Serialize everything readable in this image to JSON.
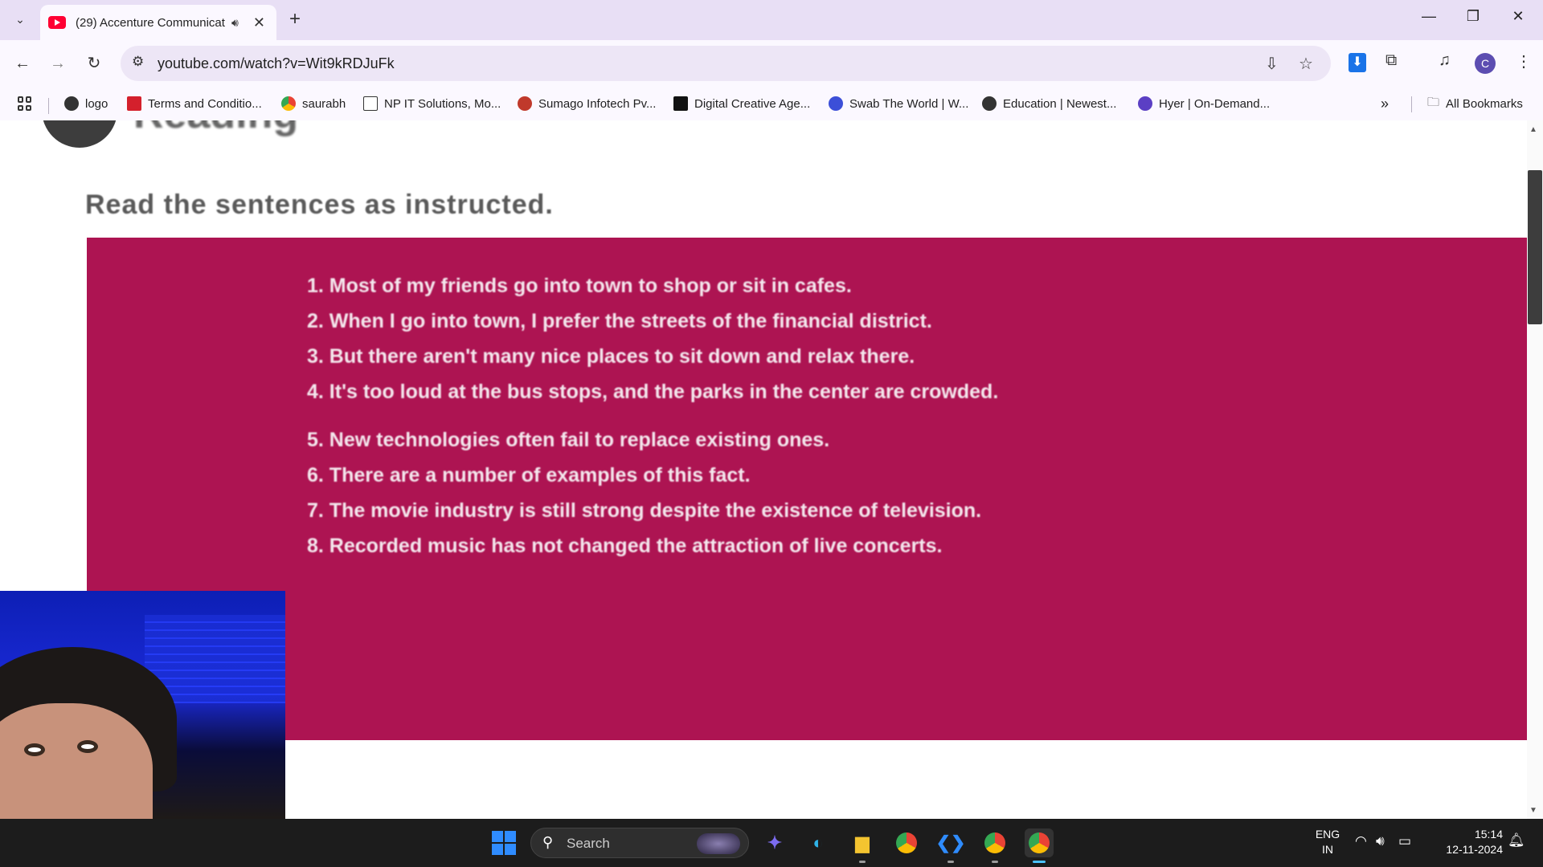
{
  "browser": {
    "tab_title": "(29) Accenture Communicat",
    "url": "youtube.com/watch?v=Wit9kRDJuFk",
    "bookmarks": [
      {
        "label": "logo",
        "color": "#333333"
      },
      {
        "label": "Terms and Conditio...",
        "color": "#d4202c"
      },
      {
        "label": "saurabh",
        "color": "#e8a33a"
      },
      {
        "label": "NP IT Solutions, Mo...",
        "color": "#222222"
      },
      {
        "label": "Sumago Infotech Pv...",
        "color": "#c0392b"
      },
      {
        "label": "Digital Creative Age...",
        "color": "#111111"
      },
      {
        "label": "Swab The World | W...",
        "color": "#3c4fd8"
      },
      {
        "label": "Education | Newest...",
        "color": "#333333"
      },
      {
        "label": "Hyer | On-Demand...",
        "color": "#5b3fc4"
      }
    ],
    "all_bookmarks_label": "All Bookmarks",
    "profile_initial": "C"
  },
  "page": {
    "heading_partial": "Reading",
    "instruction": "Read the sentences as instructed.",
    "sentences": [
      "1. Most of my friends go into town to shop or sit in cafes.",
      "2. When I go into town, I prefer the streets of the financial district.",
      "3. But there aren't many nice places to sit down and relax there.",
      "4. It's too loud at the bus stops, and the parks in the center are crowded.",
      "5. New technologies often fail to replace existing ones.",
      "6. There are a number of examples of this fact.",
      "7. The movie industry is still strong despite the existence of television.",
      "8. Recorded music has not changed the attraction of live concerts."
    ],
    "panel_color": "#ad1452"
  },
  "taskbar": {
    "search_placeholder": "Search",
    "lang_line1": "ENG",
    "lang_line2": "IN",
    "time": "15:14",
    "date": "12-11-2024"
  }
}
